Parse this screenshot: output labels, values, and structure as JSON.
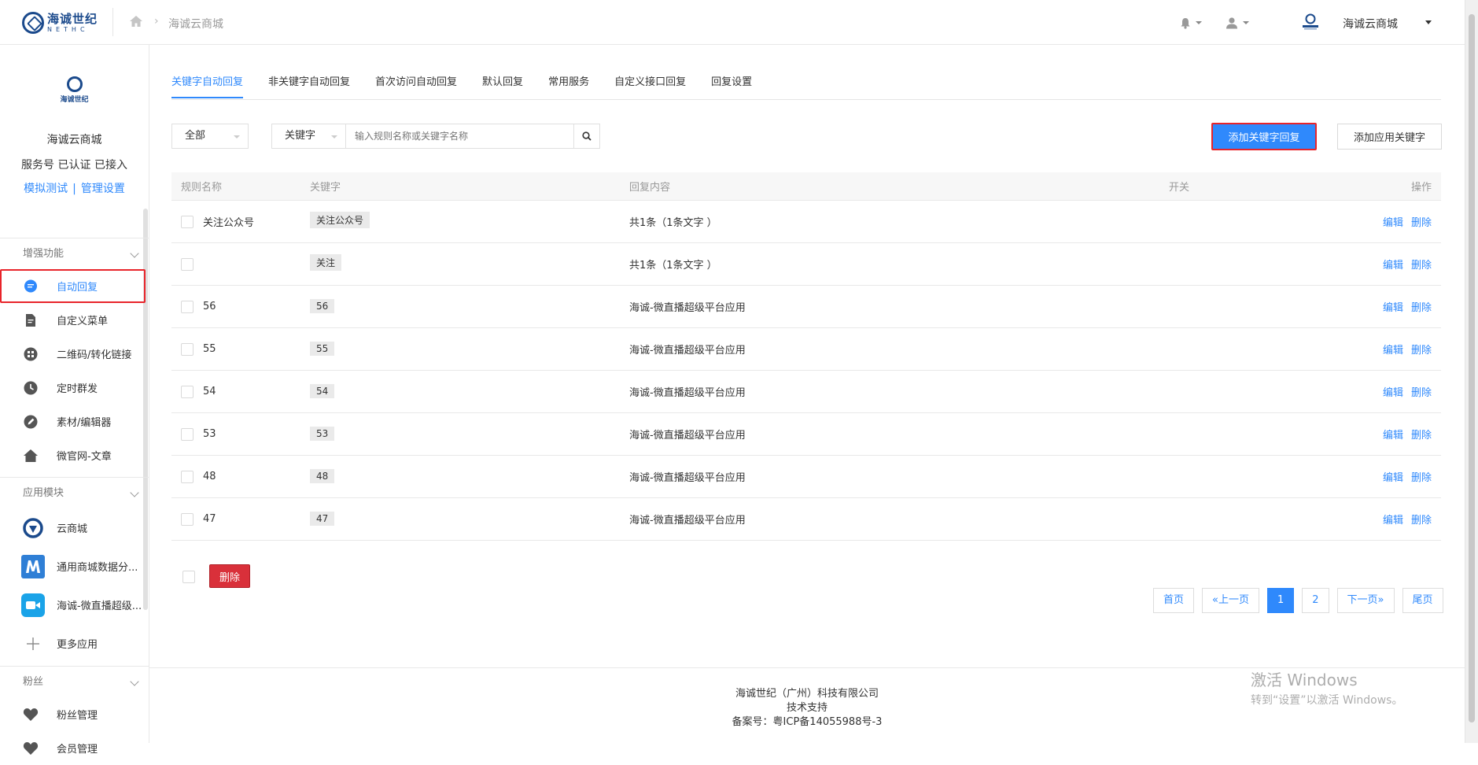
{
  "header": {
    "logo_cn": "海诚世纪",
    "logo_en": "NETHC",
    "breadcrumb": "海诚云商城",
    "account_name": "海诚云商城"
  },
  "sidebar": {
    "account": {
      "logo_text": "海诚世纪",
      "title": "海诚云商城",
      "status": "服务号 已认证 已接入",
      "link_test": "模拟测试",
      "link_sep": "|",
      "link_manage": "管理设置"
    },
    "sections": [
      {
        "title": "增强功能",
        "items": [
          {
            "label": "自动回复",
            "icon": "chat-icon"
          },
          {
            "label": "自定义菜单",
            "icon": "menu-edit-icon"
          },
          {
            "label": "二维码/转化链接",
            "icon": "qrcode-icon"
          },
          {
            "label": "定时群发",
            "icon": "clock-send-icon"
          },
          {
            "label": "素材/编辑器",
            "icon": "pencil-icon"
          },
          {
            "label": "微官网-文章",
            "icon": "home-icon"
          }
        ]
      },
      {
        "title": "应用模块",
        "apps": [
          {
            "label": "云商城",
            "icon": "nethc-logo-icon"
          },
          {
            "label": "通用商城数据分...",
            "icon": "m-app-icon"
          },
          {
            "label": "海诚-微直播超级...",
            "icon": "video-icon"
          },
          {
            "label": "更多应用",
            "icon": "plus-icon"
          }
        ]
      },
      {
        "title": "粉丝",
        "items": [
          {
            "label": "粉丝管理",
            "icon": "heart-icon"
          },
          {
            "label": "会员管理",
            "icon": "heart-icon"
          }
        ]
      }
    ]
  },
  "tabs": [
    "关键字自动回复",
    "非关键字自动回复",
    "首次访问自动回复",
    "默认回复",
    "常用服务",
    "自定义接口回复",
    "回复设置"
  ],
  "filters": {
    "scope": "全部",
    "field": "关键字",
    "search_placeholder": "输入规则名称或关键字名称"
  },
  "buttons": {
    "add_keyword": "添加关键字回复",
    "add_app_keyword": "添加应用关键字",
    "delete": "删除"
  },
  "table": {
    "headers": [
      "规则名称",
      "关键字",
      "回复内容",
      "开关",
      "操作"
    ],
    "edit_label": "编辑",
    "delete_label": "删除",
    "rows": [
      {
        "name": "关注公众号",
        "keyword": "关注公众号",
        "content": "共1条（1条文字 ）",
        "enabled": true
      },
      {
        "name": "",
        "keyword": "关注",
        "content": "共1条（1条文字 ）",
        "enabled": true
      },
      {
        "name": "56",
        "keyword": "56",
        "content": "海诚-微直播超级平台应用",
        "enabled": true
      },
      {
        "name": "55",
        "keyword": "55",
        "content": "海诚-微直播超级平台应用",
        "enabled": true
      },
      {
        "name": "54",
        "keyword": "54",
        "content": "海诚-微直播超级平台应用",
        "enabled": true
      },
      {
        "name": "53",
        "keyword": "53",
        "content": "海诚-微直播超级平台应用",
        "enabled": true
      },
      {
        "name": "48",
        "keyword": "48",
        "content": "海诚-微直播超级平台应用",
        "enabled": true
      },
      {
        "name": "47",
        "keyword": "47",
        "content": "海诚-微直播超级平台应用",
        "enabled": true
      }
    ]
  },
  "pagination": {
    "first": "首页",
    "prev": "«上一页",
    "pages": [
      "1",
      "2"
    ],
    "current": "1",
    "next": "下一页»",
    "last": "尾页"
  },
  "footer": {
    "company": "海诚世纪（广州）科技有限公司",
    "support": "技术支持",
    "icp": "备案号：粤ICP备14055988号-3"
  },
  "watermark": {
    "line1": "激活 Windows",
    "line2": "转到“设置”以激活 Windows。"
  },
  "colors": {
    "accent": "#2f89fc",
    "danger": "#d9303a",
    "highlight_border": "#e8242a"
  }
}
